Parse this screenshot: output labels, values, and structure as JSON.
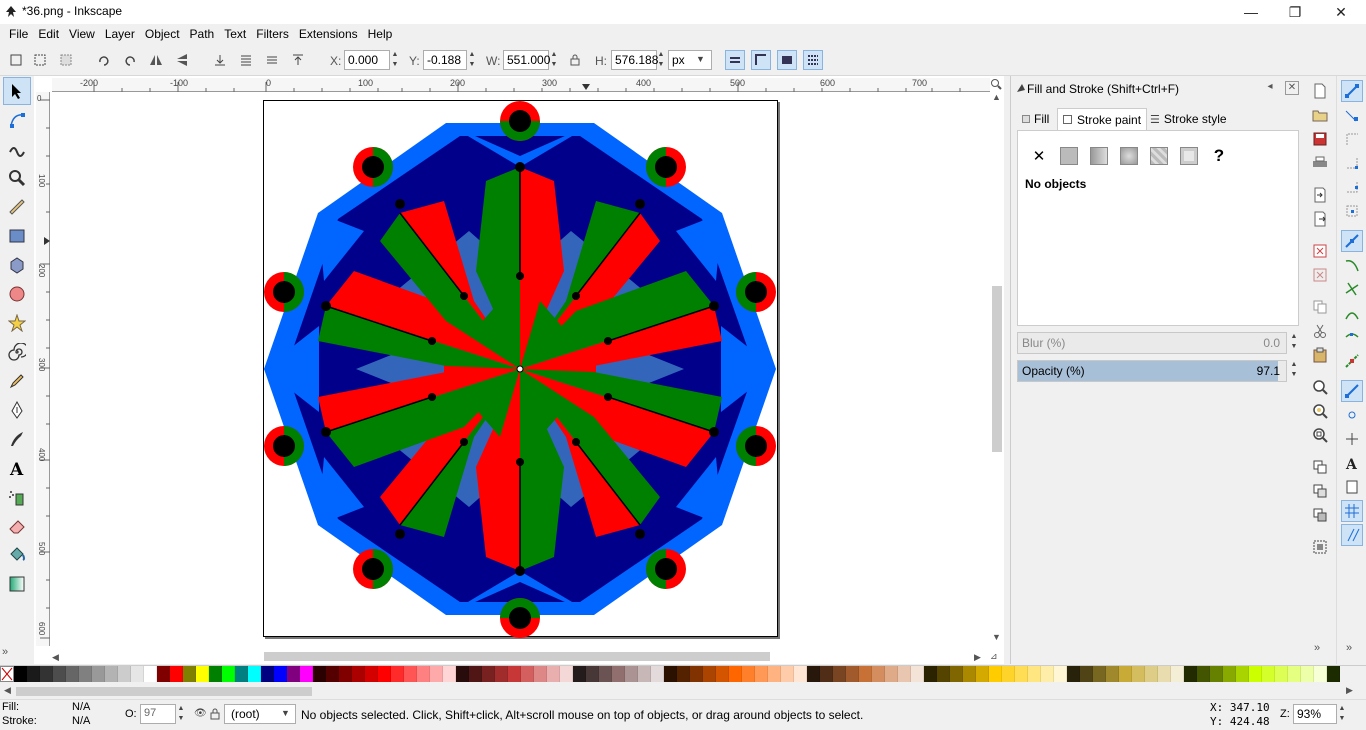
{
  "window": {
    "title": "*36.png - Inkscape",
    "minimize": "—",
    "maximize": "❐",
    "close": "✕"
  },
  "menu": [
    "File",
    "Edit",
    "View",
    "Layer",
    "Object",
    "Path",
    "Text",
    "Filters",
    "Extensions",
    "Help"
  ],
  "toolbar": {
    "x_label": "X:",
    "x_value": "0.000",
    "y_label": "Y:",
    "y_value": "-0.188",
    "w_label": "W:",
    "w_value": "551.000",
    "h_label": "H:",
    "h_value": "576.188",
    "unit": "px"
  },
  "ruler": {
    "h_ticks": [
      "-200",
      "-100",
      "0",
      "100",
      "200",
      "300",
      "400",
      "500",
      "600",
      "700"
    ],
    "v_ticks": [
      "0",
      "100",
      "200",
      "300",
      "400",
      "500",
      "600"
    ]
  },
  "dialog": {
    "title": "Fill and Stroke (Shift+Ctrl+F)",
    "tabs": {
      "fill": "Fill",
      "stroke_paint": "Stroke paint",
      "stroke_style": "Stroke style"
    },
    "paint_none": "✕",
    "paint_unset": "?",
    "status": "No objects",
    "blur_label": "Blur (%)",
    "blur_value": "0.0",
    "opacity_label": "Opacity (%)",
    "opacity_value": "97.1",
    "opacity_level": 0.971
  },
  "statusbar": {
    "fill_label": "Fill:",
    "fill_value": "N/A",
    "stroke_label": "Stroke:",
    "stroke_value": "N/A",
    "o_label": "O:",
    "o_value": "97",
    "layer": "(root)",
    "message": "No objects selected. Click, Shift+click, Alt+scroll mouse on top of objects, or drag around objects to select.",
    "cursor_x": "X:  347.10",
    "cursor_y": "Y:  424.48",
    "zoom_label": "Z:",
    "zoom_value": "93%"
  },
  "colors": {
    "accent": "#cfe3f7",
    "red": "#ff0000",
    "green": "#008000",
    "blue": "#0066ff",
    "navy": "#00008b",
    "steel": "#3366bb"
  },
  "palette": [
    "#000000",
    "#1a1a1a",
    "#333333",
    "#4d4d4d",
    "#666666",
    "#808080",
    "#999999",
    "#b3b3b3",
    "#cccccc",
    "#e6e6e6",
    "#ffffff",
    "#800000",
    "#ff0000",
    "#808000",
    "#ffff00",
    "#008000",
    "#00ff00",
    "#008080",
    "#00ffff",
    "#000080",
    "#0000ff",
    "#800080",
    "#ff00ff",
    "#2b0000",
    "#550000",
    "#800000",
    "#aa0000",
    "#d40000",
    "#ff0000",
    "#ff2a2a",
    "#ff5555",
    "#ff8080",
    "#ffaaaa",
    "#ffd5d5",
    "#280b0b",
    "#501616",
    "#782121",
    "#a02c2c",
    "#c83737",
    "#d35f5f",
    "#de8787",
    "#e9afaf",
    "#f4d7d7",
    "#241c1c",
    "#483737",
    "#6c5353",
    "#916f6f",
    "#ac9393",
    "#c8b7b7",
    "#e3dbdb",
    "#2b1100",
    "#552200",
    "#803300",
    "#aa4400",
    "#d45500",
    "#ff6600",
    "#ff7f2a",
    "#ff9955",
    "#ffb380",
    "#ffccaa",
    "#ffe6d5",
    "#28170b",
    "#502d16",
    "#784421",
    "#a05a2c",
    "#c87137",
    "#d38d5f",
    "#deaa87",
    "#e9c6af",
    "#f4e3d7",
    "#2b2200",
    "#554400",
    "#806600",
    "#aa8800",
    "#d4aa00",
    "#ffcc00",
    "#ffd42a",
    "#ffdd55",
    "#ffe680",
    "#ffeeaa",
    "#fff6d5",
    "#28220b",
    "#504416",
    "#786721",
    "#a0892c",
    "#c8ab37",
    "#d4bd5f",
    "#decd87",
    "#e9ddaf",
    "#f4eed7",
    "#222b00",
    "#445500",
    "#668000",
    "#88aa00",
    "#aad400",
    "#ccff00",
    "#d4ff2a",
    "#ddff55",
    "#e5ff80",
    "#eeffaa",
    "#f6ffd5",
    "#1c2b00"
  ]
}
